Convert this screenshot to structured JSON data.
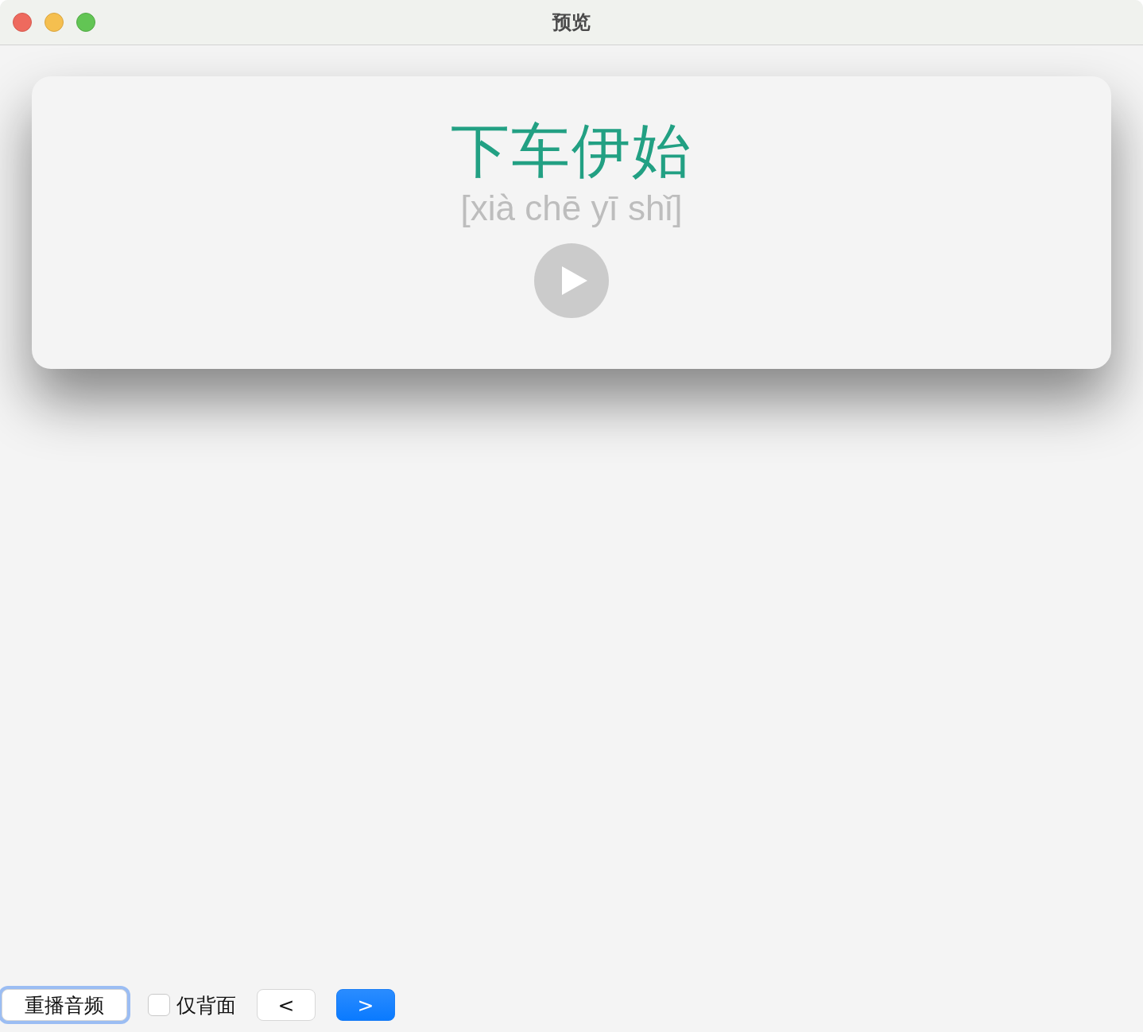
{
  "window": {
    "title": "预览"
  },
  "card": {
    "word": "下车伊始",
    "pinyin": "[xià chē yī shǐ]"
  },
  "controls": [
    {
      "kind": "button",
      "label": "重播音频",
      "focused": true,
      "primary": false
    },
    {
      "kind": "checkbox",
      "label": "仅背面",
      "checked": false
    },
    {
      "kind": "button",
      "label": "<",
      "focused": false,
      "primary": false
    },
    {
      "kind": "button",
      "label": ">",
      "focused": false,
      "primary": true
    }
  ]
}
